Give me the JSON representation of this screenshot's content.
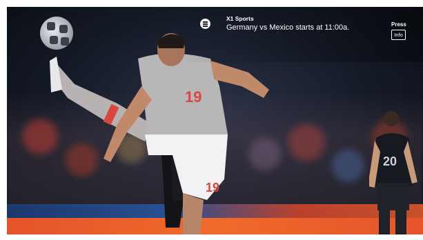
{
  "notification": {
    "source": "X1 Sports",
    "message": "Germany vs Mexico starts at 11:00a.",
    "icon": "menu-icon"
  },
  "hint": {
    "press_label": "Press",
    "button_label": "Info"
  },
  "player": {
    "jersey_number": "19",
    "back_number": "19"
  },
  "opponent": {
    "jersey_number": "20"
  },
  "colors": {
    "accent_orange": "#f06a2c",
    "jersey_gray": "#b9b6b8",
    "number_red": "#d8463c"
  }
}
